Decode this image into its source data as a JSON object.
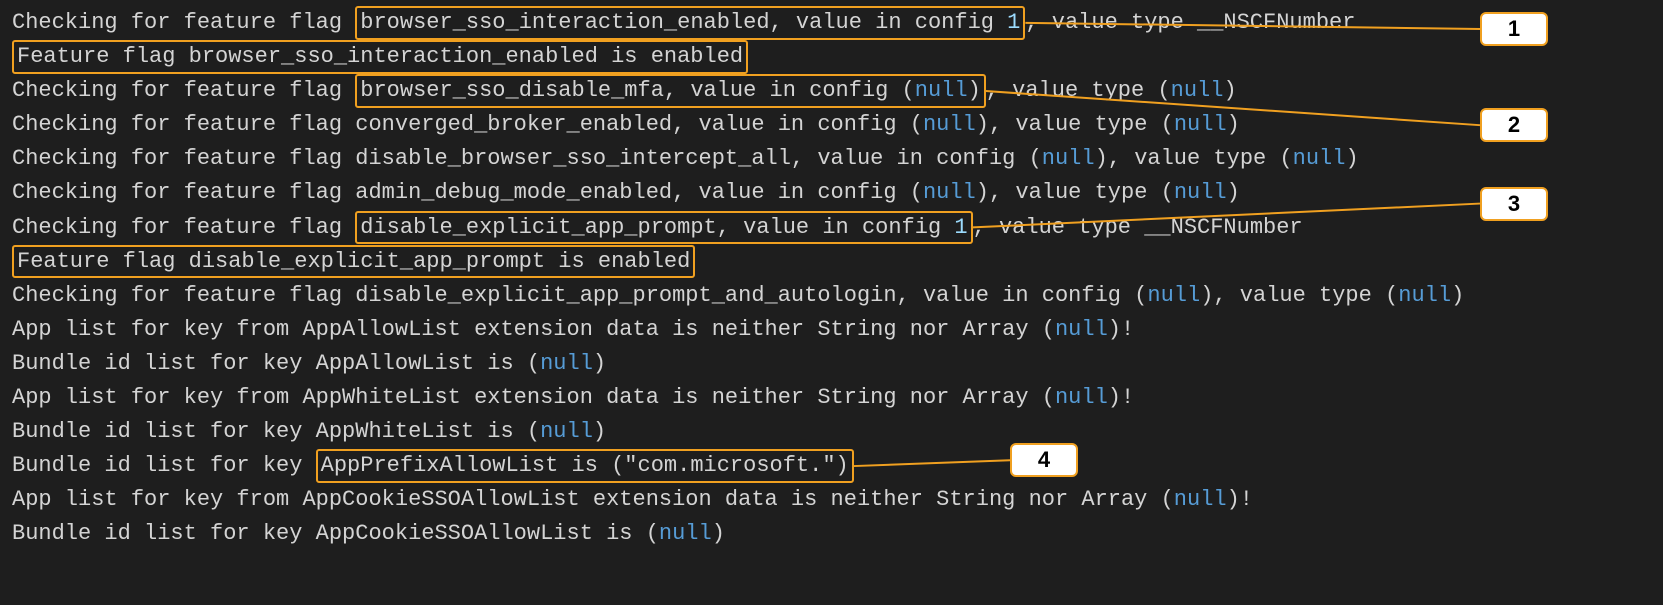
{
  "lines": {
    "l1_prefix": "Checking for feature flag ",
    "l1_mark_a": "browser_sso_interaction_enabled, value in config ",
    "l1_mark_num": "1",
    "l1_suffix": ", value type __NSCFNumber",
    "l2_mark": "Feature flag browser_sso_interaction_enabled is enabled",
    "l3_prefix": "Checking for feature flag ",
    "l3_mark_a": "browser_sso_disable_mfa, value in config (",
    "l3_mark_null": "null",
    "l3_mark_b": ")",
    "l3_suffix_a": ", value type (",
    "l3_suffix_null": "null",
    "l3_suffix_b": ")",
    "l4_a": "Checking for feature flag converged_broker_enabled, value in config (",
    "l4_null1": "null",
    "l4_b": "), value type (",
    "l4_null2": "null",
    "l4_c": ")",
    "l5_a": "Checking for feature flag disable_browser_sso_intercept_all, value in config (",
    "l5_null1": "null",
    "l5_b": "), value type (",
    "l5_null2": "null",
    "l5_c": ")",
    "l6_a": "Checking for feature flag admin_debug_mode_enabled, value in config (",
    "l6_null1": "null",
    "l6_b": "), value type (",
    "l6_null2": "null",
    "l6_c": ")",
    "l7_prefix": "Checking for feature flag ",
    "l7_mark_a": "disable_explicit_app_prompt, value in config ",
    "l7_mark_num": "1",
    "l7_suffix": ", value type __NSCFNumber",
    "l8_mark": "Feature flag disable_explicit_app_prompt is enabled",
    "l9_a": "Checking for feature flag disable_explicit_app_prompt_and_autologin, value in config (",
    "l9_null1": "null",
    "l9_b": "), value type (",
    "l9_null2": "null",
    "l9_c": ")",
    "l10_a": "App list for key from AppAllowList extension data is neither String nor Array (",
    "l10_null": "null",
    "l10_b": ")!",
    "l11_a": "Bundle id list for key AppAllowList is (",
    "l11_null": "null",
    "l11_b": ")",
    "l12_a": "App list for key from AppWhiteList extension data is neither String nor Array (",
    "l12_null": "null",
    "l12_b": ")!",
    "l13_a": "Bundle id list for key AppWhiteList is (",
    "l13_null": "null",
    "l13_b": ")",
    "l14_prefix": "Bundle id list for key ",
    "l14_mark": "AppPrefixAllowList is (\"com.microsoft.\")",
    "l15_a": "App list for key from AppCookieSSOAllowList extension data is neither String nor Array (",
    "l15_null": "null",
    "l15_b": ")!",
    "l16_a": "Bundle id list for key AppCookieSSOAllowList is (",
    "l16_null": "null",
    "l16_b": ")"
  },
  "callouts": {
    "c1": "1",
    "c2": "2",
    "c3": "3",
    "c4": "4"
  }
}
